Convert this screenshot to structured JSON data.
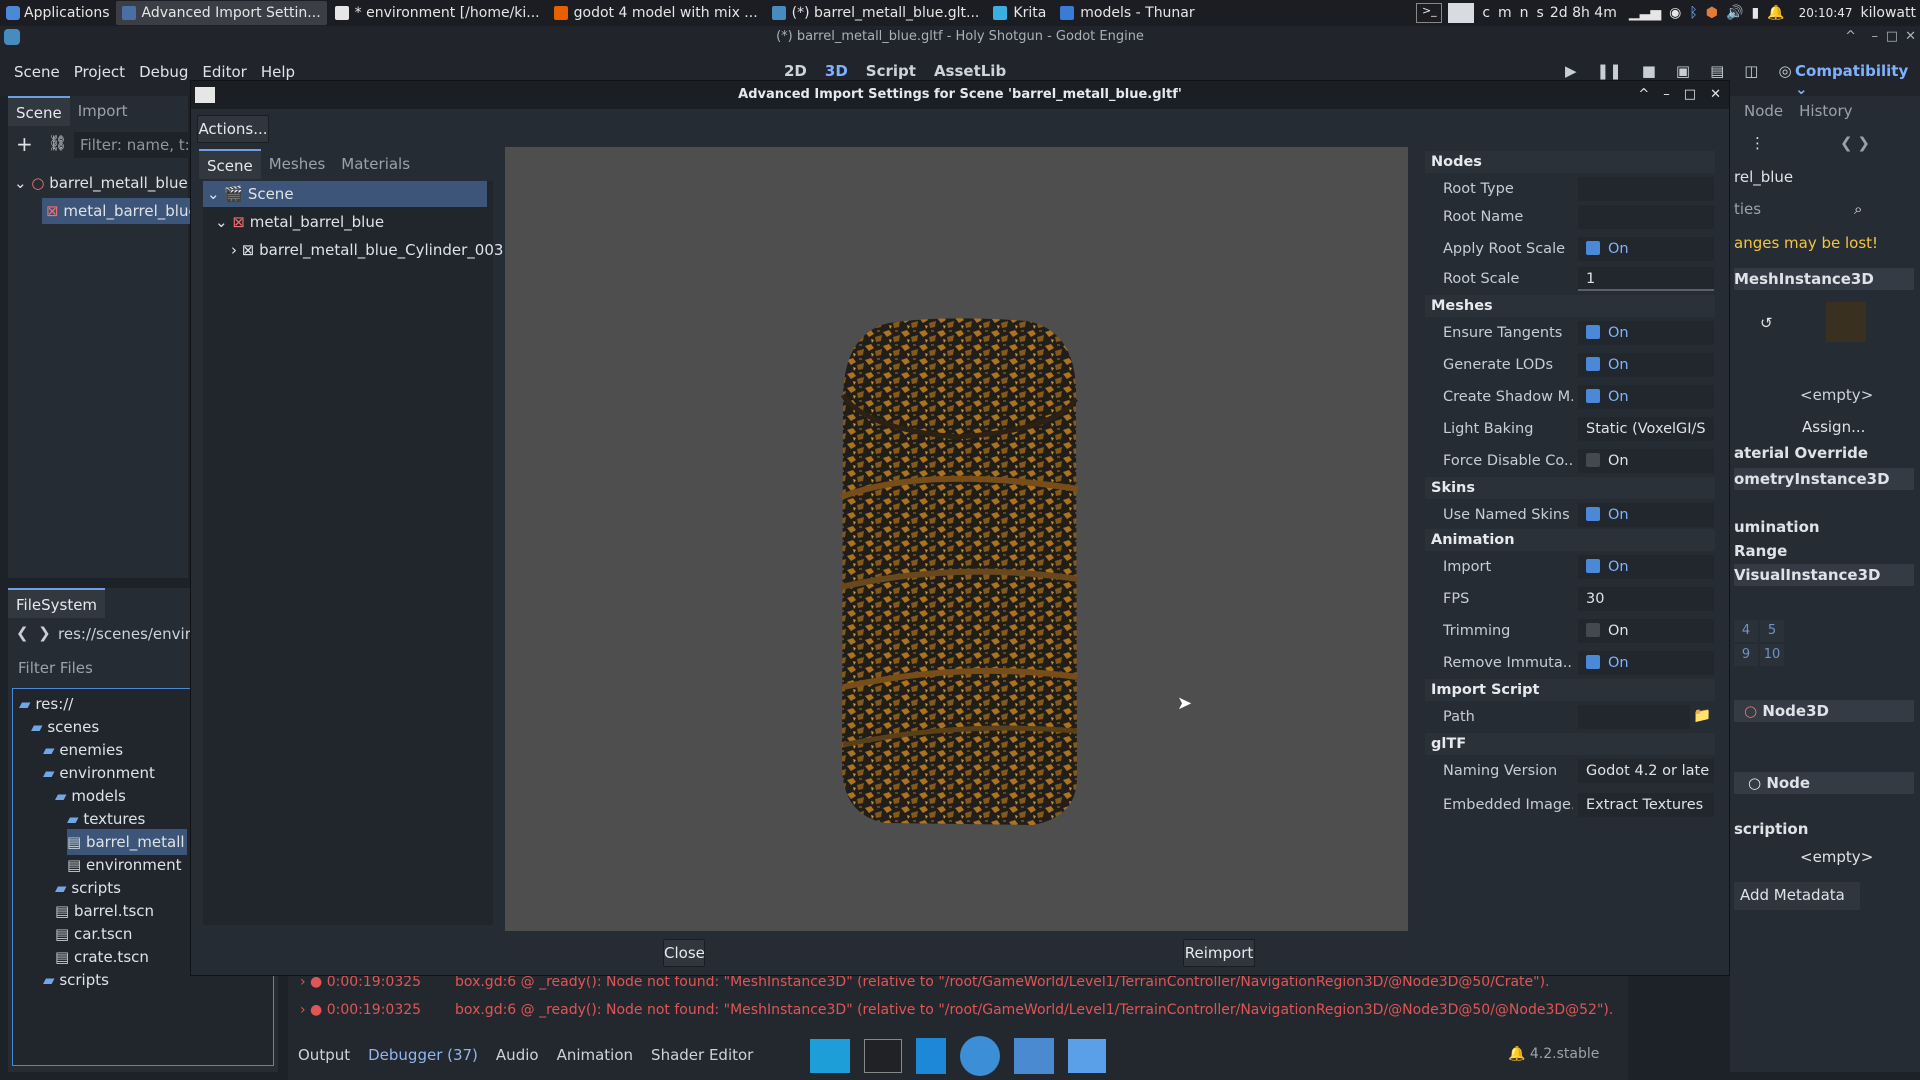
{
  "taskbar": {
    "applications": "Applications",
    "tasks": [
      {
        "label": "Advanced Import Settin...",
        "active": true,
        "color": "#4a6fa5"
      },
      {
        "label": "* environment [/home/ki...",
        "active": false,
        "color": "#e6e6e6"
      },
      {
        "label": "godot 4 model with mix ...",
        "active": false,
        "color": "#e66000"
      },
      {
        "label": "(*) barrel_metall_blue.glt...",
        "active": false,
        "color": "#478cbf"
      },
      {
        "label": "Krita",
        "active": false,
        "color": "#3bb0e0"
      },
      {
        "label": "models - Thunar",
        "active": false,
        "color": "#3a7bd5"
      }
    ],
    "tray_letters": [
      "c",
      "m",
      "n",
      "s"
    ],
    "uptime": "2d 8h 4m",
    "clock": "20:10:47",
    "user": "kilowatt"
  },
  "godot": {
    "window_title": "(*) barrel_metall_blue.gltf - Holy Shotgun - Godot Engine",
    "menu": [
      "Scene",
      "Project",
      "Debug",
      "Editor",
      "Help"
    ],
    "workspaces": [
      "2D",
      "3D",
      "Script",
      "AssetLib"
    ],
    "renderer": "Compatibility"
  },
  "left_dock": {
    "tabs": [
      "Scene",
      "Import"
    ],
    "filter_placeholder": "Filter: name, t:ty",
    "tree": [
      "barrel_metall_blue",
      "metal_barrel_blue"
    ],
    "filesystem_tab": "FileSystem",
    "path": "res://scenes/environ",
    "filter_files": "Filter Files",
    "files": [
      "res://",
      "scenes",
      "enemies",
      "environment",
      "models",
      "textures",
      "barrel_metall",
      "environment",
      "scripts",
      "barrel.tscn",
      "car.tscn",
      "crate.tscn",
      "scripts"
    ]
  },
  "right_dock": {
    "tabs": [
      "Node",
      "History"
    ],
    "node_name": "rel_blue",
    "filter": "ties",
    "warning": "anges may be lost!",
    "class": "MeshInstance3D",
    "empty1": "<empty>",
    "assign": "Assign...",
    "material_override": "aterial Override",
    "geometry": "ometryInstance3D",
    "lumination": "umination",
    "range": "Range",
    "visual": "VisualInstance3D",
    "layers": [
      "4",
      "5",
      "9",
      "10"
    ],
    "node3d": "Node3D",
    "node": "Node",
    "description": "scription",
    "empty2": "<empty>",
    "add_metadata": "Add Metadata"
  },
  "bottom": {
    "errors": [
      {
        "time": "0:00:19:0325",
        "msg": "box.gd:6 @ _ready(): Node not found: \"MeshInstance3D\" (relative to \"/root/GameWorld/Level1/TerrainController/NavigationRegion3D/@Node3D@50/Crate\")."
      },
      {
        "time": "0:00:19:0325",
        "msg": "box.gd:6 @ _ready(): Node not found: \"MeshInstance3D\" (relative to \"/root/GameWorld/Level1/TerrainController/NavigationRegion3D/@Node3D@50/@Node3D@52\")."
      }
    ],
    "tabs": [
      "Output",
      "Debugger (37)",
      "Audio",
      "Animation",
      "Shader Editor"
    ],
    "version": "4.2.stable"
  },
  "dialog": {
    "title": "Advanced Import Settings for Scene 'barrel_metall_blue.gltf'",
    "actions": "Actions...",
    "tabs": [
      "Scene",
      "Meshes",
      "Materials"
    ],
    "tree": [
      "Scene",
      "metal_barrel_blue",
      "barrel_metall_blue_Cylinder_003"
    ],
    "close": "Close",
    "reimport": "Reimport",
    "sections": {
      "nodes": "Nodes",
      "meshes": "Meshes",
      "skins": "Skins",
      "animation": "Animation",
      "import_script": "Import Script",
      "gltf": "glTF"
    },
    "props": {
      "root_type": "Root Type",
      "root_name": "Root Name",
      "apply_root_scale": "Apply Root Scale",
      "root_scale": "Root Scale",
      "root_scale_value": "1",
      "ensure_tangents": "Ensure Tangents",
      "generate_lods": "Generate LODs",
      "create_shadow": "Create Shadow M...",
      "light_baking": "Light Baking",
      "light_baking_value": "Static (VoxelGI/S",
      "force_disable": "Force Disable Co...",
      "use_named_skins": "Use Named Skins",
      "import": "Import",
      "fps": "FPS",
      "fps_value": "30",
      "trimming": "Trimming",
      "remove_immutable": "Remove Immuta...",
      "path": "Path",
      "naming_version": "Naming Version",
      "naming_version_value": "Godot 4.2 or late",
      "embedded_image": "Embedded Image...",
      "embedded_image_value": "Extract Textures",
      "on": "On"
    }
  }
}
